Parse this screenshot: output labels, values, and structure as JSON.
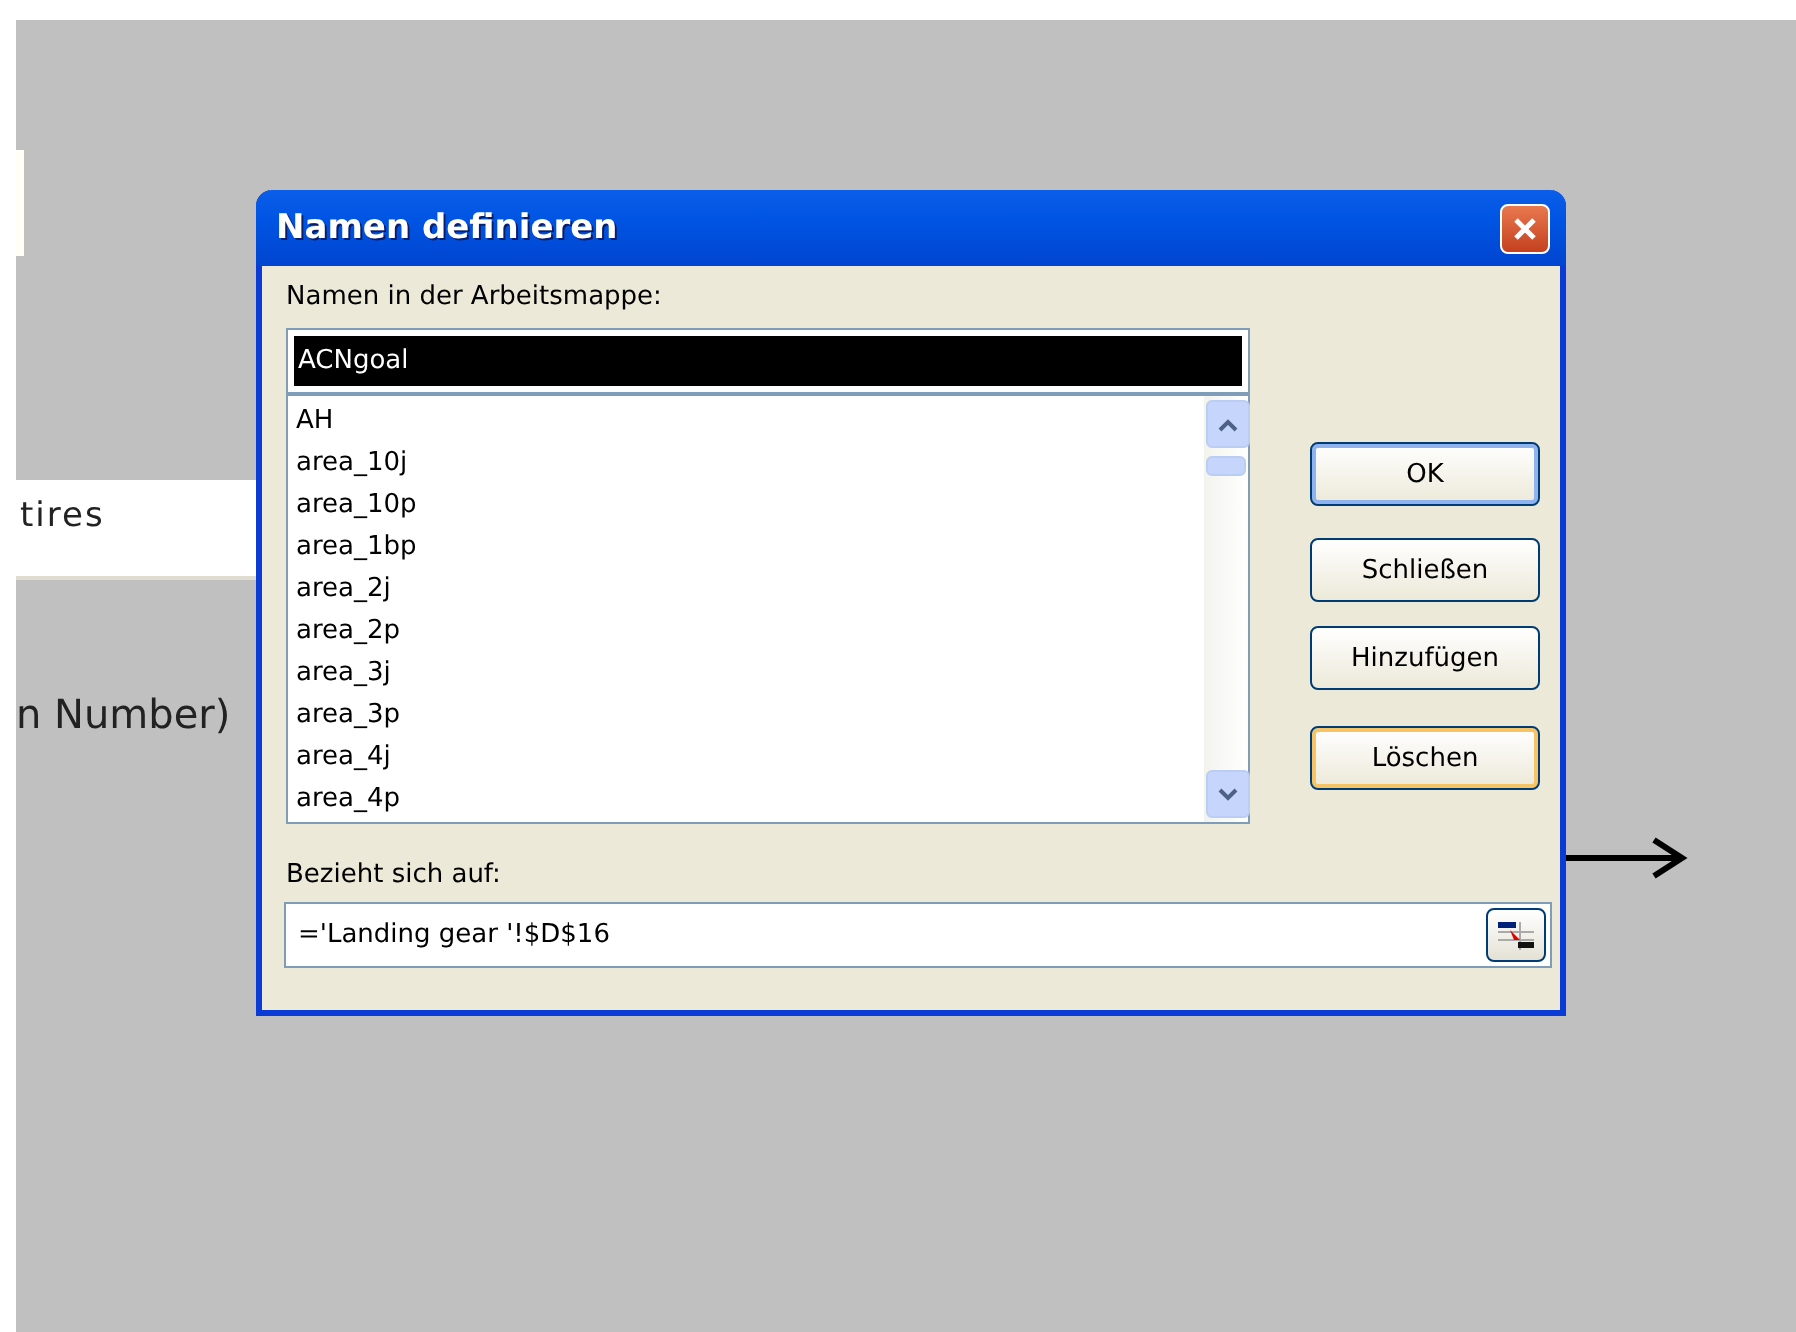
{
  "background": {
    "cell_text": "tires",
    "label_text": "n Number)"
  },
  "dialog": {
    "title": "Namen definieren",
    "names_label": "Namen in der Arbeitsmappe:",
    "name_field": {
      "value": "ACNgoal"
    },
    "names": [
      {
        "label": "AH",
        "selected": false
      },
      {
        "label": "area_10j",
        "selected": false
      },
      {
        "label": "area_10p",
        "selected": false
      },
      {
        "label": "area_1bp",
        "selected": false
      },
      {
        "label": "area_2j",
        "selected": false
      },
      {
        "label": "area_2p",
        "selected": false
      },
      {
        "label": "area_3j",
        "selected": false
      },
      {
        "label": "area_3p",
        "selected": false
      },
      {
        "label": "area_4j",
        "selected": false
      },
      {
        "label": "area_4p",
        "selected": false
      }
    ],
    "buttons": [
      {
        "label": "OK",
        "kind": "default"
      },
      {
        "label": "Schließen",
        "kind": "normal"
      },
      {
        "label": "Hinzufügen",
        "kind": "normal"
      },
      {
        "label": "Löschen",
        "kind": "focused"
      }
    ],
    "refers_label": "Bezieht sich auf:",
    "refers_field": {
      "value": "='Landing gear '!$D$16"
    }
  }
}
